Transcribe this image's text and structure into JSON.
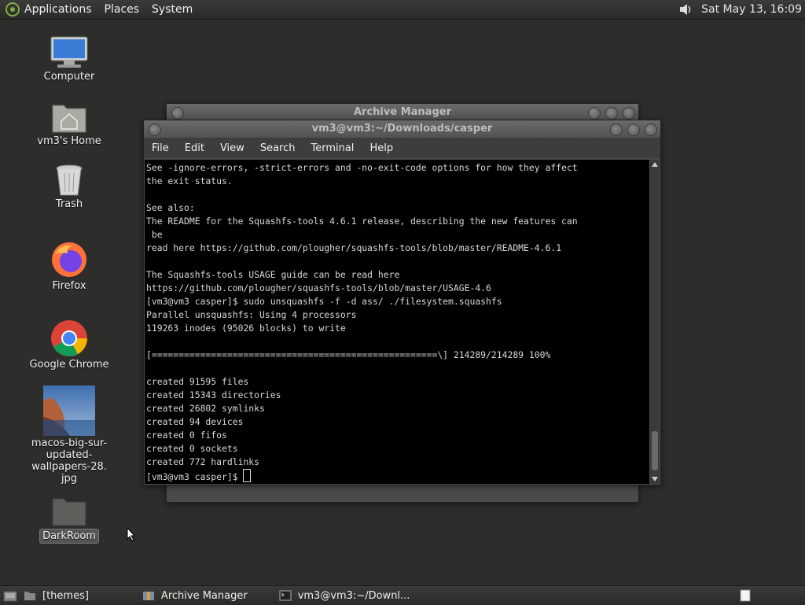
{
  "top_panel": {
    "menus": [
      "Applications",
      "Places",
      "System"
    ],
    "clock": "Sat May 13, 16:09"
  },
  "desktop": {
    "icons": [
      {
        "label": "Computer"
      },
      {
        "label": "vm3's Home"
      },
      {
        "label": "Trash"
      },
      {
        "label": "Firefox"
      },
      {
        "label": "Google Chrome"
      },
      {
        "label": "macos-big-sur-\nupdated-wallpapers-28.\njpg"
      },
      {
        "label": "DarkRoom"
      }
    ]
  },
  "archive_window": {
    "title": "Archive Manager"
  },
  "terminal": {
    "title": "vm3@vm3:~/Downloads/casper",
    "menu": [
      "File",
      "Edit",
      "View",
      "Search",
      "Terminal",
      "Help"
    ],
    "lines": [
      "See -ignore-errors, -strict-errors and -no-exit-code options for how they affect",
      "the exit status.",
      "",
      "See also:",
      "The README for the Squashfs-tools 4.6.1 release, describing the new features can",
      " be",
      "read here https://github.com/plougher/squashfs-tools/blob/master/README-4.6.1",
      "",
      "The Squashfs-tools USAGE guide can be read here",
      "https://github.com/plougher/squashfs-tools/blob/master/USAGE-4.6",
      "[vm3@vm3 casper]$ sudo unsquashfs -f -d ass/ ./filesystem.squashfs",
      "Parallel unsquashfs: Using 4 processors",
      "119263 inodes (95026 blocks) to write",
      "",
      "[=====================================================\\] 214289/214289 100%",
      "",
      "created 91595 files",
      "created 15343 directories",
      "created 26802 symlinks",
      "created 94 devices",
      "created 0 fifos",
      "created 0 sockets",
      "created 772 hardlinks"
    ],
    "prompt": "[vm3@vm3 casper]$ "
  },
  "bottom_panel": {
    "tasks": [
      "[themes]",
      "Archive Manager",
      "vm3@vm3:~/Downl..."
    ]
  }
}
